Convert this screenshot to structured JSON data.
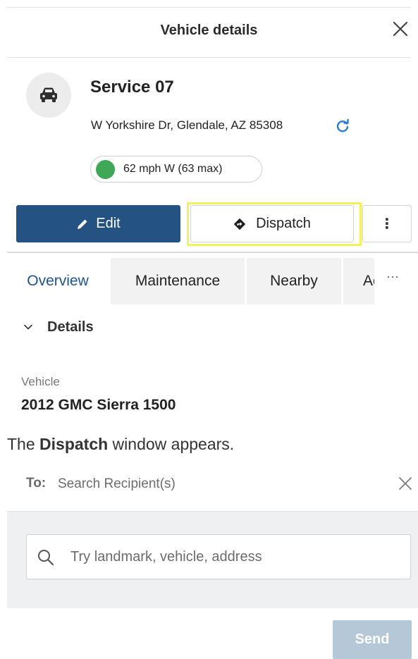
{
  "vehicle_panel": {
    "title": "Vehicle details",
    "close_icon": "close-icon",
    "vehicle": {
      "icon": "car-icon",
      "name": "Service 07",
      "address": "W Yorkshire Dr, Glendale, AZ 85308",
      "refresh_icon": "refresh-icon",
      "speed_status": "62 mph W (63 max)",
      "status_color": "#3fa857"
    },
    "actions": {
      "edit_label": "Edit",
      "edit_icon": "pencil-icon",
      "dispatch_label": "Dispatch",
      "dispatch_icon": "directions-diamond-icon",
      "more_label": "⋮",
      "highlight_color": "#f2f25a"
    },
    "tabs": [
      {
        "label": "Overview",
        "active": true
      },
      {
        "label": "Maintenance",
        "active": false
      },
      {
        "label": "Nearby",
        "active": false
      },
      {
        "label": "Ac",
        "active": false
      }
    ],
    "tabs_overflow": "···",
    "details": {
      "section_label": "Details",
      "vehicle_label": "Vehicle",
      "vehicle_value": "2012 GMC Sierra 1500"
    }
  },
  "instruction": {
    "prefix": "The ",
    "bold": "Dispatch",
    "suffix": " window appears."
  },
  "dispatch_panel": {
    "to_label": "To:",
    "to_placeholder": "Search Recipient(s)",
    "search_placeholder": "Try landmark, vehicle, address",
    "send_label": "Send",
    "send_color": "#b5c8d8"
  },
  "colors": {
    "primary": "#245283",
    "active_tab": "#1f5390",
    "refresh": "#2a7bd1"
  }
}
